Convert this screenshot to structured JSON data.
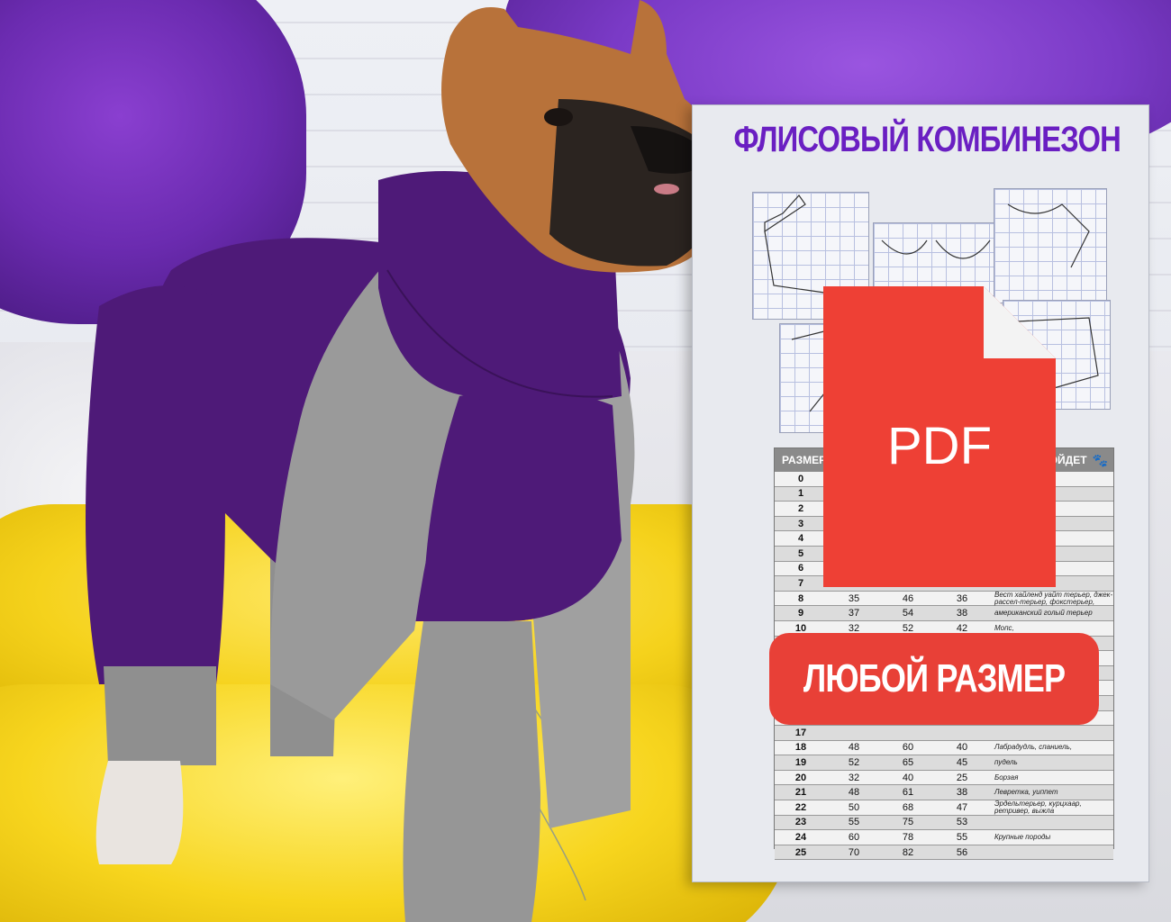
{
  "title": "ФЛИСОВЫЙ КОМБИНЕЗОН",
  "pdf_label": "PDF",
  "cta_label": "ЛЮБОЙ РАЗМЕР",
  "table": {
    "header": "РАЗМЕР",
    "header_right": "ПОДОЙДЕТ",
    "rows": [
      {
        "size": "0",
        "a": "",
        "b": "",
        "c": "",
        "breed": "Породы"
      },
      {
        "size": "1",
        "a": "",
        "b": "",
        "c": "",
        "breed": ", той терьер,"
      },
      {
        "size": "2",
        "a": "",
        "b": "",
        "c": "",
        "breed": "уа, той терьер,"
      },
      {
        "size": "3",
        "a": "",
        "b": "",
        "c": "",
        "breed": "ру"
      },
      {
        "size": "4",
        "a": "",
        "b": "",
        "c": "",
        "breed": "олонка"
      },
      {
        "size": "5",
        "a": "",
        "b": "",
        "c": "",
        "breed": "рц, йорк, , грифон"
      },
      {
        "size": "6",
        "a": "",
        "b": "",
        "c": "",
        "breed": ", пудель"
      },
      {
        "size": "7",
        "a": "",
        "b": "",
        "c": "",
        "breed": ""
      },
      {
        "size": "8",
        "a": "35",
        "b": "46",
        "c": "36",
        "breed": "Вест хайленд уайт терьер, джек-рассел-терьер, фокстерьер,"
      },
      {
        "size": "9",
        "a": "37",
        "b": "54",
        "c": "38",
        "breed": "американский голый терьер"
      },
      {
        "size": "10",
        "a": "32",
        "b": "52",
        "c": "42",
        "breed": "Мопс,"
      },
      {
        "size": "11",
        "a": "",
        "b": "",
        "c": "",
        "breed": ""
      },
      {
        "size": "12",
        "a": "",
        "b": "",
        "c": "",
        "breed": ""
      },
      {
        "size": "13",
        "a": "",
        "b": "",
        "c": "",
        "breed": ""
      },
      {
        "size": "14",
        "a": "",
        "b": "",
        "c": "",
        "breed": ""
      },
      {
        "size": "15",
        "a": "",
        "b": "",
        "c": "",
        "breed": ""
      },
      {
        "size": "16",
        "a": "",
        "b": "",
        "c": "",
        "breed": ""
      },
      {
        "size": "17",
        "a": "",
        "b": "",
        "c": "",
        "breed": ""
      },
      {
        "size": "18",
        "a": "48",
        "b": "60",
        "c": "40",
        "breed": "Лабрадудль, спаниель,"
      },
      {
        "size": "19",
        "a": "52",
        "b": "65",
        "c": "45",
        "breed": "пудель"
      },
      {
        "size": "20",
        "a": "32",
        "b": "40",
        "c": "25",
        "breed": "Борзая"
      },
      {
        "size": "21",
        "a": "48",
        "b": "61",
        "c": "38",
        "breed": "Левретка, уиппет"
      },
      {
        "size": "22",
        "a": "50",
        "b": "68",
        "c": "47",
        "breed": "Эрдельтерьер, курцхаар, ретривер, выжла"
      },
      {
        "size": "23",
        "a": "55",
        "b": "75",
        "c": "53",
        "breed": ""
      },
      {
        "size": "24",
        "a": "60",
        "b": "78",
        "c": "55",
        "breed": "Крупные породы"
      },
      {
        "size": "25",
        "a": "70",
        "b": "82",
        "c": "56",
        "breed": ""
      }
    ]
  },
  "colors": {
    "title": "#6a1fc2",
    "pdf_red": "#ee4035",
    "button_red": "#e84037",
    "jumpsuit_purple": "#4e1a78",
    "jumpsuit_gray": "#9a9a9a"
  },
  "icons": [
    "pdf-file-icon",
    "paw-icon"
  ]
}
